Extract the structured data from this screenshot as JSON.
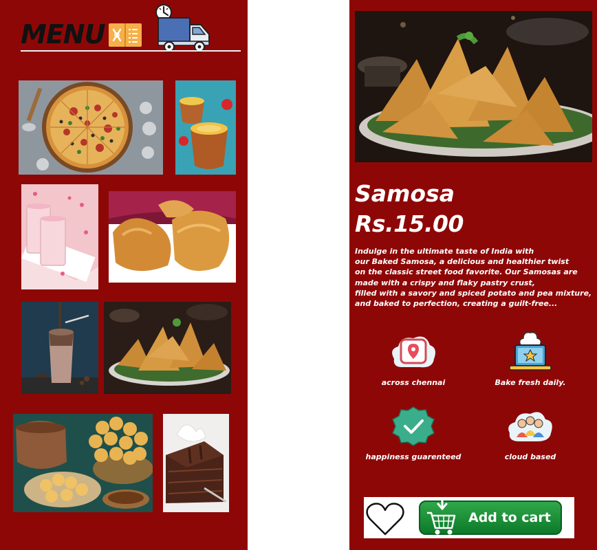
{
  "menu": {
    "title": "MENU"
  },
  "tiles": [
    {
      "id": "pizza",
      "icon": "pizza-image"
    },
    {
      "id": "kulfi",
      "icon": "kulfi-image"
    },
    {
      "id": "rose-milk",
      "icon": "rose-milk-image"
    },
    {
      "id": "puffs",
      "icon": "puffs-image"
    },
    {
      "id": "cold-coffee",
      "icon": "cold-coffee-image"
    },
    {
      "id": "samosa",
      "icon": "samosa-image"
    },
    {
      "id": "pani-puri",
      "icon": "pani-puri-image"
    },
    {
      "id": "chocolate-cake",
      "icon": "chocolate-cake-image"
    }
  ],
  "product": {
    "name": "Samosa",
    "price": "Rs.15.00",
    "description_lines": [
      "Indulge in the ultimate taste of India with",
      "our Baked Samosa, a delicious and healthier twist",
      "on the classic street food favorite. Our Samosas are",
      "made with a crispy and flaky pastry crust,",
      "filled with a savory and spiced potato and pea mixture,",
      "and baked to perfection, creating a guilt-free..."
    ]
  },
  "features": [
    {
      "label": "across chennai",
      "icon": "location-icon"
    },
    {
      "label": "Bake fresh daily.",
      "icon": "chef-laptop-icon"
    },
    {
      "label": "happiness guarenteed",
      "icon": "check-badge-icon"
    },
    {
      "label": "cloud based",
      "icon": "team-cloud-icon"
    }
  ],
  "cart": {
    "label": "Add to cart"
  },
  "colors": {
    "panel_bg": "#8e0707",
    "text": "#ffffff",
    "cart_green": "#1a8f37"
  }
}
